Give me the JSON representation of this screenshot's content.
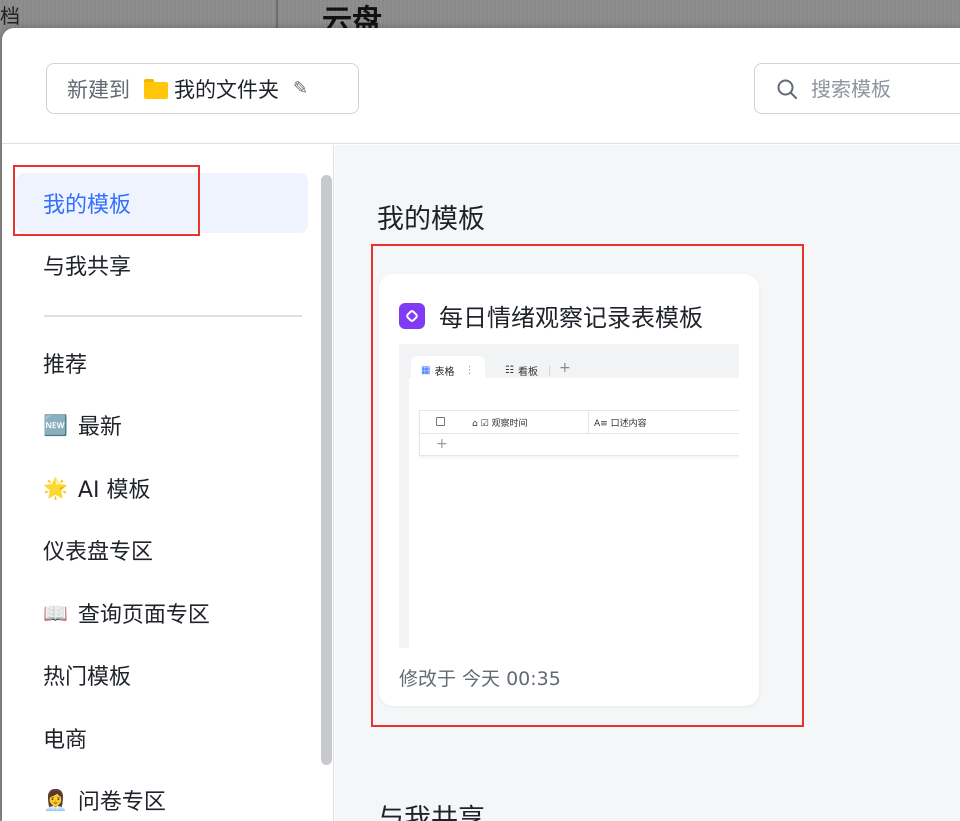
{
  "backdrop": {
    "left_fragment": "档",
    "title": "云盘"
  },
  "header": {
    "create_prefix": "新建到",
    "folder_name": "我的文件夹",
    "search_placeholder": "搜索模板"
  },
  "sidebar": {
    "items": [
      {
        "label": "我的模板",
        "icon": "",
        "active": true
      },
      {
        "label": "与我共享",
        "icon": ""
      },
      {
        "label": "推荐",
        "icon": ""
      },
      {
        "label": "最新",
        "icon": "🆕"
      },
      {
        "label": "AI 模板",
        "icon": "🌟"
      },
      {
        "label": "仪表盘专区",
        "icon": ""
      },
      {
        "label": "查询页面专区",
        "icon": "📖"
      },
      {
        "label": "热门模板",
        "icon": ""
      },
      {
        "label": "电商",
        "icon": ""
      },
      {
        "label": "问卷专区",
        "icon": "👩‍💼"
      }
    ]
  },
  "main": {
    "section_mine": "我的模板",
    "section_shared": "与我共享",
    "card": {
      "title": "每日情绪观察记录表模板",
      "modified": "修改于 今天 00:35",
      "preview": {
        "tab1": "表格",
        "tab2": "看板",
        "col1": "观察时间",
        "col2": "口述内容"
      }
    }
  },
  "colors": {
    "accent": "#3370ff",
    "highlight_box": "#e8332f",
    "app_icon": "#7f3bf5"
  }
}
